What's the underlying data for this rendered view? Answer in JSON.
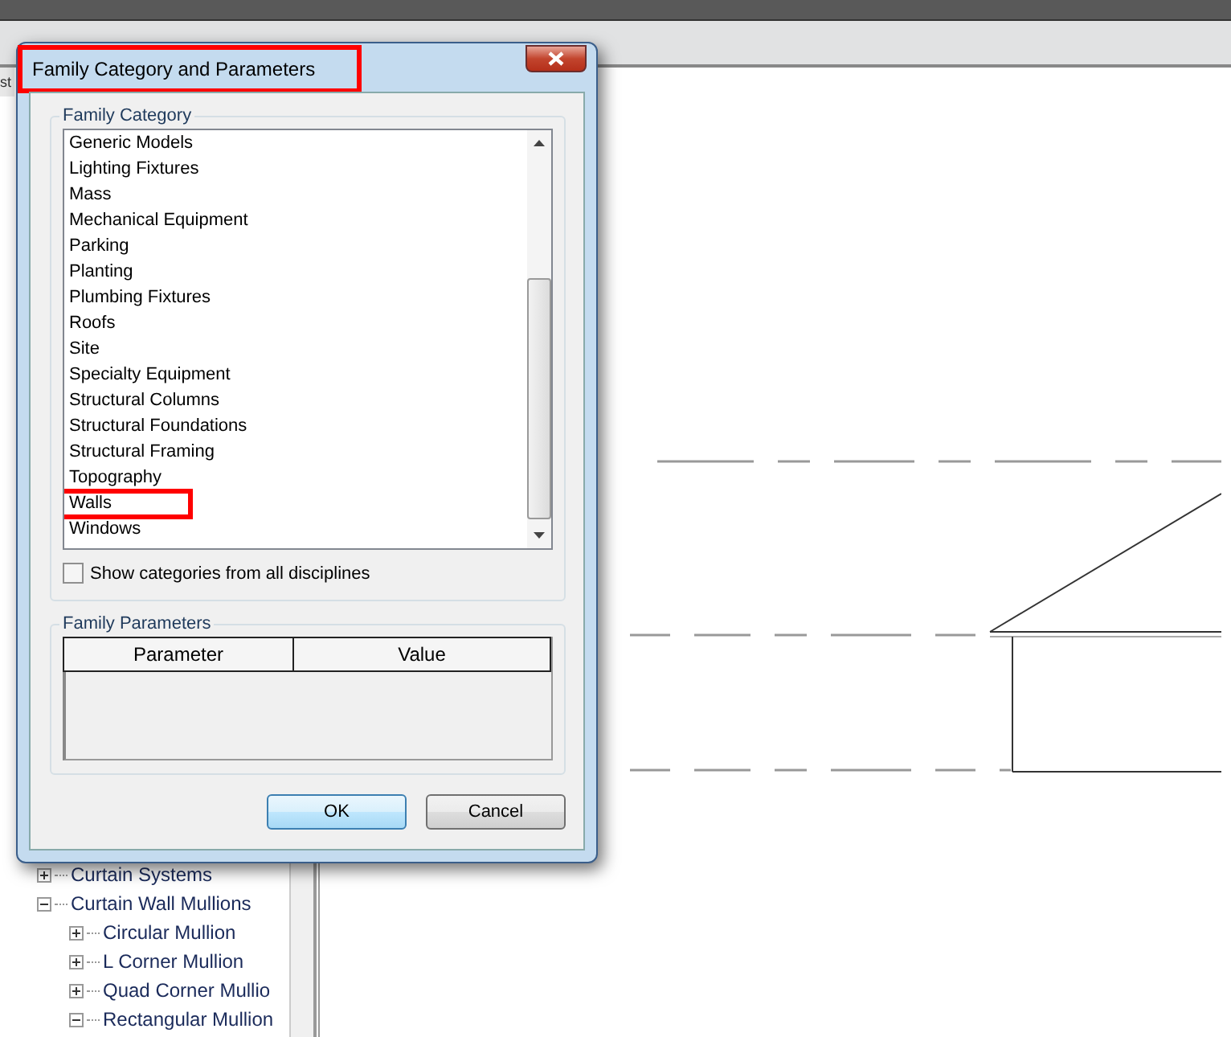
{
  "browser": {
    "tab": "st",
    "tree": [
      {
        "label": "Curtain Systems",
        "expanded": false
      },
      {
        "label": "Curtain Wall Mullions",
        "expanded": true,
        "children": [
          {
            "label": "Circular Mullion",
            "expanded": false
          },
          {
            "label": "L Corner Mullion",
            "expanded": false
          },
          {
            "label": "Quad Corner Mullio",
            "expanded": false
          },
          {
            "label": "Rectangular Mullion",
            "expanded": true
          }
        ]
      }
    ]
  },
  "dialog": {
    "title": "Family Category and Parameters",
    "title_highlighted": true,
    "category_group": "Family Category",
    "categories": [
      {
        "label": "Generic Models",
        "selected": false
      },
      {
        "label": "Lighting Fixtures",
        "selected": false
      },
      {
        "label": "Mass",
        "selected": false
      },
      {
        "label": "Mechanical Equipment",
        "selected": false
      },
      {
        "label": "Parking",
        "selected": false
      },
      {
        "label": "Planting",
        "selected": false
      },
      {
        "label": "Plumbing Fixtures",
        "selected": false
      },
      {
        "label": "Roofs",
        "selected": false
      },
      {
        "label": "Site",
        "selected": false
      },
      {
        "label": "Specialty Equipment",
        "selected": false
      },
      {
        "label": "Structural Columns",
        "selected": false
      },
      {
        "label": "Structural Foundations",
        "selected": false
      },
      {
        "label": "Structural Framing",
        "selected": false
      },
      {
        "label": "Topography",
        "selected": false
      },
      {
        "label": "Walls",
        "selected": false,
        "highlighted": true
      },
      {
        "label": "Windows",
        "selected": false
      }
    ],
    "show_all": {
      "label": "Show categories from all disciplines",
      "checked": false
    },
    "parameters_group": "Family Parameters",
    "columns": [
      "Parameter",
      "Value"
    ],
    "buttons": [
      "OK",
      "Cancel"
    ]
  }
}
